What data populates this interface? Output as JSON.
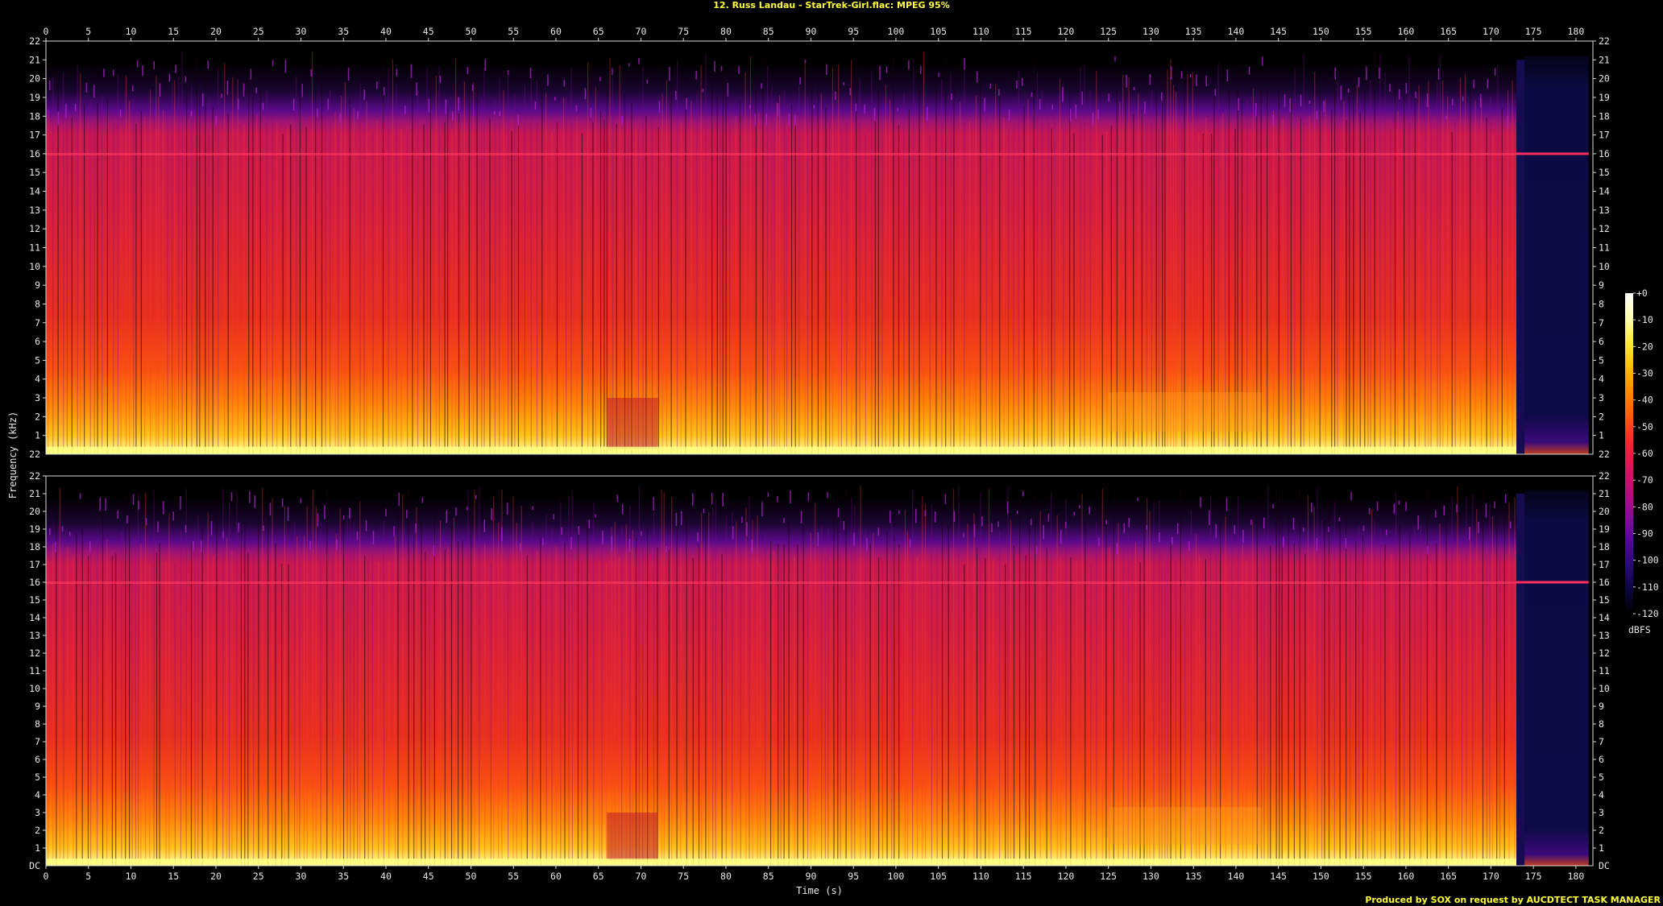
{
  "header": {
    "title": "12. Russ Landau - StarTrek-Girl.flac: MPEG 95%"
  },
  "footer": {
    "credit": "Produced by SOX on request by AUCDTECT TASK MANAGER"
  },
  "chart_data": {
    "type": "heatmap",
    "title": "12. Russ Landau - StarTrek-Girl.flac: MPEG 95%",
    "xlabel": "Time (s)",
    "ylabel": "Frequency (kHz)",
    "xlim": [
      0,
      182
    ],
    "ylim": [
      0,
      22
    ],
    "x_ticks": [
      0,
      5,
      10,
      15,
      20,
      25,
      30,
      35,
      40,
      45,
      50,
      55,
      60,
      65,
      70,
      75,
      80,
      85,
      90,
      95,
      100,
      105,
      110,
      115,
      120,
      125,
      130,
      135,
      140,
      145,
      150,
      155,
      160,
      165,
      170,
      175,
      180
    ],
    "y_ticks": [
      1,
      2,
      3,
      4,
      5,
      6,
      7,
      8,
      9,
      10,
      11,
      12,
      13,
      14,
      15,
      16,
      17,
      18,
      19,
      20,
      21,
      22
    ],
    "y_bottom_label_top_panel": "22",
    "y_bottom_label_bottom_panel": "DC",
    "channels": 2,
    "audio_end_s": 173,
    "lowpass_khz": 16,
    "colorbar": {
      "label": "dBFS",
      "ticks": [
        "+0",
        "-10",
        "-20",
        "-30",
        "-40",
        "-50",
        "-60",
        "-70",
        "-80",
        "-90",
        "-100",
        "-110",
        "-120"
      ],
      "range": [
        -120,
        0
      ],
      "colors": [
        "#000000",
        "#0c0540",
        "#2a0a78",
        "#58069a",
        "#8c0a9a",
        "#b8107a",
        "#d8185a",
        "#f02a2a",
        "#ff5a10",
        "#ff8a00",
        "#ffbb10",
        "#ffe840",
        "#ffffb0",
        "#ffffff"
      ]
    },
    "background_tail_color": "#0c0a42",
    "text_color": "#ffff3a",
    "grid": false
  }
}
